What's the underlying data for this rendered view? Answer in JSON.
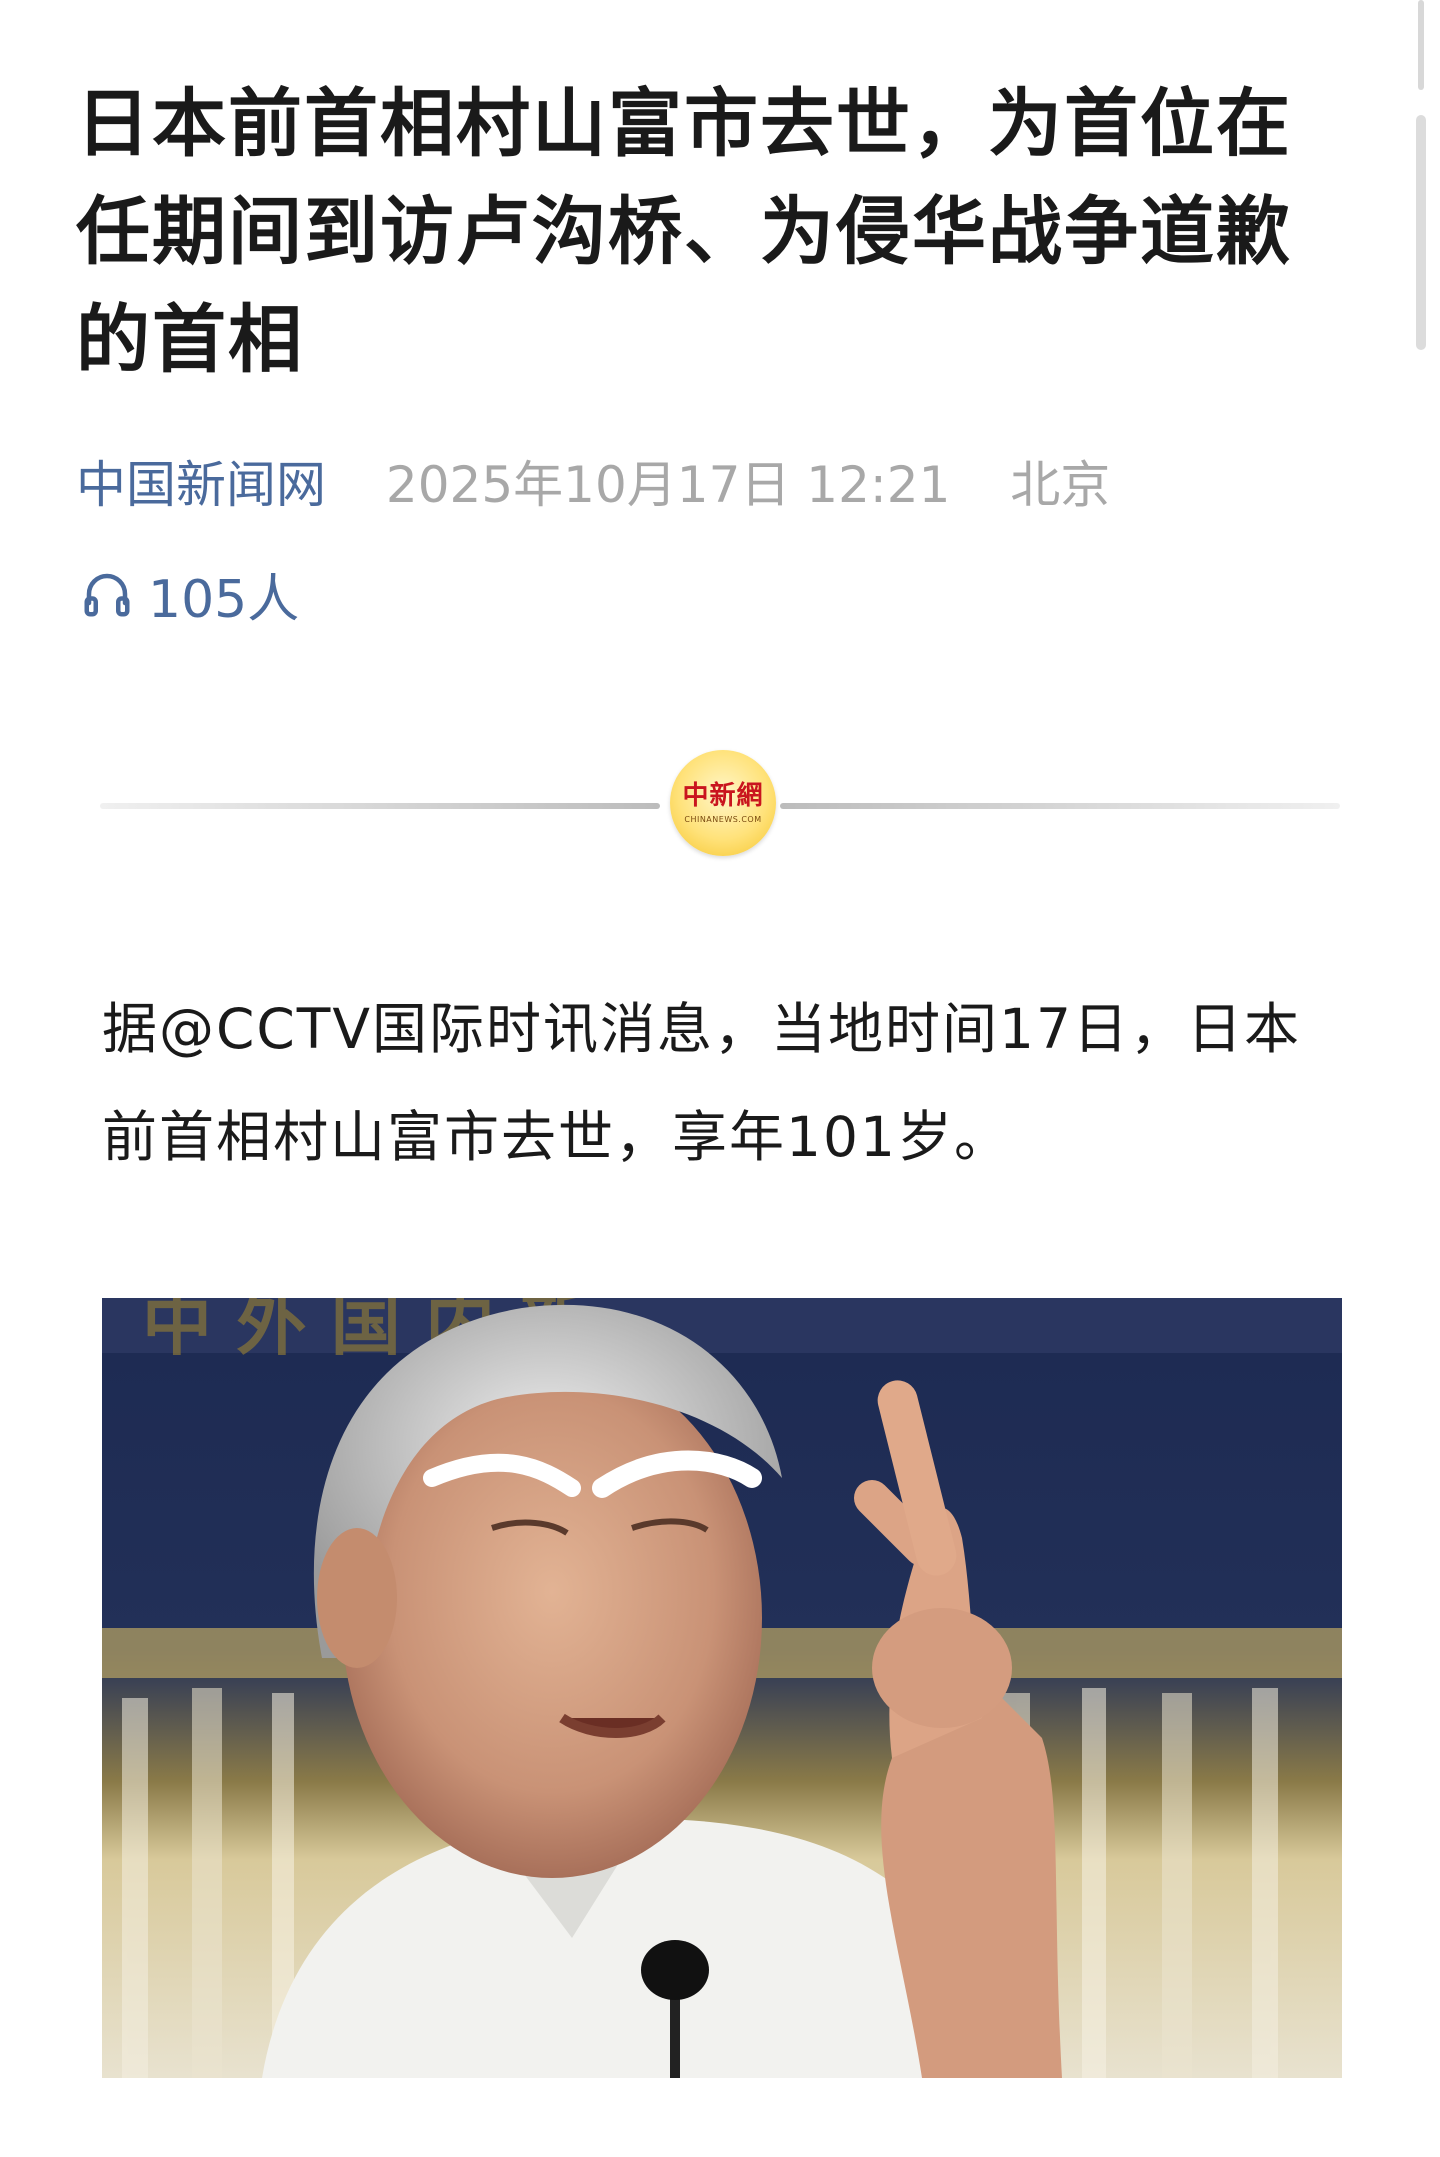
{
  "article": {
    "title": "日本前首相村山富市去世，为首位在任期间到访卢沟桥、为侵华战争道歉的首相",
    "source": "中国新闻网",
    "datetime": "2025年10月17日 12:21",
    "location": "北京",
    "listen_count": "105人",
    "body": "据@CCTV国际时讯消息，当地时间17日，日本前首相村山富市去世，享年101岁。"
  },
  "divider_logo": {
    "text_cn": "中新網",
    "text_en": "CHINANEWS.COM"
  },
  "icons": {
    "listen": "headphones-icon"
  },
  "colors": {
    "source_blue": "#4a6a9c",
    "meta_gray": "#a8a8a8",
    "title_black": "#1a1a1a",
    "logo_red": "#c9151e",
    "logo_gold": "#f5c42a"
  }
}
